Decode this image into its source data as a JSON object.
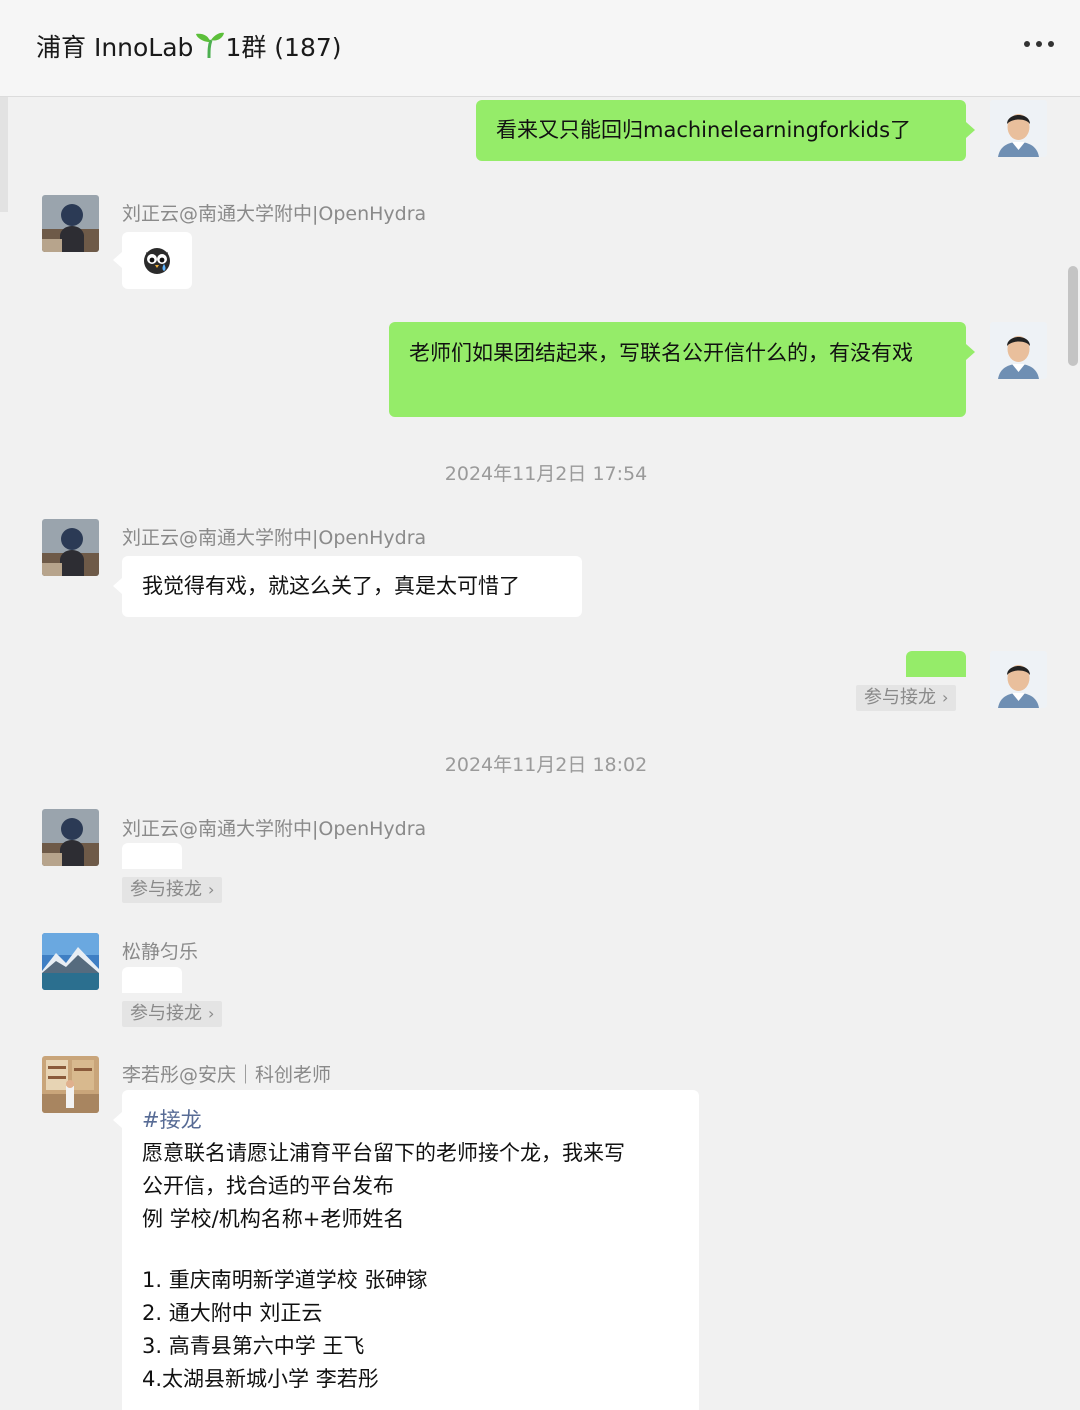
{
  "header": {
    "title_prefix": "浦育 InnoLab",
    "title_suffix": "1群 (187)",
    "more_icon": "more-dots-icon"
  },
  "messages": {
    "m1": {
      "text": "看来又只能回归machinelearningforkids了"
    },
    "m2": {
      "sender": "刘正云@南通大学附中|OpenHydra",
      "emoji": "crying-owl-sticker"
    },
    "m3": {
      "text": "老师们如果团结起来，写联名公开信什么的，有没有戏"
    },
    "t1": {
      "time": "2024年11月2日 17:54"
    },
    "m4": {
      "sender": "刘正云@南通大学附中|OpenHydra",
      "text": "我觉得有戏，就这么关了，真是太可惜了"
    },
    "m5": {
      "join_label": "参与接龙"
    },
    "t2": {
      "time": "2024年11月2日 18:02"
    },
    "m6": {
      "sender": "刘正云@南通大学附中|OpenHydra",
      "join_label": "参与接龙"
    },
    "m7": {
      "sender": "松静匀乐",
      "join_label": "参与接龙"
    },
    "m8": {
      "sender": "李若彤@安庆｜科创老师",
      "tag": "#接龙",
      "lines": [
        "愿意联名请愿让浦育平台留下的老师接个龙，我来写",
        "公开信，找合适的平台发布",
        "例 学校/机构名称+老师姓名",
        "",
        "1. 重庆南明新学道学校 张砷镓",
        "2. 通大附中 刘正云",
        "3. 高青县第六中学 王飞",
        "4.太湖县新城小学 李若彤"
      ]
    }
  },
  "colors": {
    "self_bubble": "#95ec69",
    "other_bubble": "#ffffff",
    "background": "#f1f1f1",
    "tag_link": "#576b95"
  }
}
